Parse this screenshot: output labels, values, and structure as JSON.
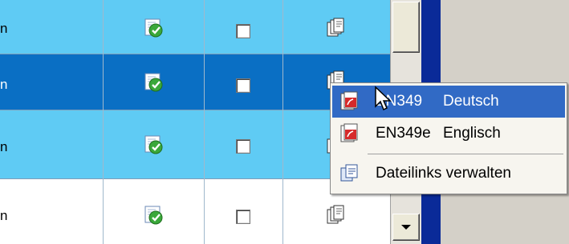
{
  "grid": {
    "rows": [
      {
        "state": "normal",
        "name_trunc": "n",
        "status_icon": "edit-check-icon",
        "checked": false,
        "doc_icon": "document-stack-icon"
      },
      {
        "state": "selected",
        "name_trunc": "n",
        "status_icon": "edit-check-icon",
        "checked": false,
        "doc_icon": "document-stack-icon"
      },
      {
        "state": "normal",
        "name_trunc": "n",
        "status_icon": "edit-check-icon",
        "checked": false,
        "doc_icon": "document-stack-icon"
      },
      {
        "state": "white",
        "name_trunc": "n",
        "status_icon": "edit-check-icon",
        "checked": false,
        "doc_icon": "document-stack-icon"
      }
    ]
  },
  "colors": {
    "row_light": "#5fcbf4",
    "row_selected": "#0a6fc4",
    "menu_highlight": "#316ac5",
    "window_border": "#0a2a98"
  },
  "context_menu": {
    "items": [
      {
        "code": "EN349",
        "lang": "Deutsch",
        "icon": "pdf-icon",
        "highlighted": true
      },
      {
        "code": "EN349e",
        "lang": "Englisch",
        "icon": "pdf-icon",
        "highlighted": false
      }
    ],
    "manage_label": "Dateilinks verwalten",
    "manage_icon": "links-manage-icon"
  },
  "scrollbar": {
    "down_arrow_icon": "chevron-down-icon"
  }
}
